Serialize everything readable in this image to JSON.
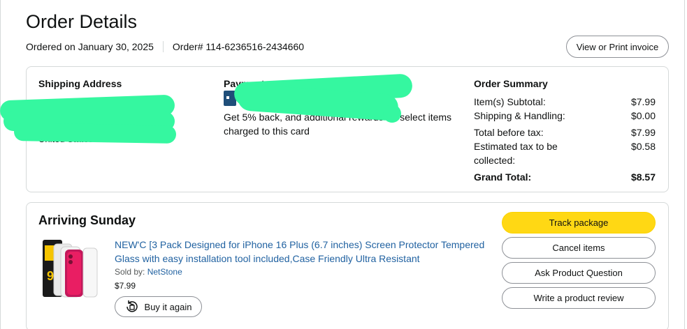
{
  "header": {
    "title": "Order Details",
    "ordered_on": "Ordered on January 30, 2025",
    "order_number": "Order# 114-6236516-2434660",
    "invoice_button": "View or Print invoice"
  },
  "shipping": {
    "label": "Shipping Address",
    "country": "United States"
  },
  "payment": {
    "label": "Payment method",
    "reward_text": "Get 5% back, and additional rewards on select items charged to this card"
  },
  "summary": {
    "label": "Order Summary",
    "rows": [
      {
        "label": "Item(s) Subtotal:",
        "value": "$7.99"
      },
      {
        "label": "Shipping & Handling:",
        "value": "$0.00"
      },
      {
        "label": "Total before tax:",
        "value": "$7.99"
      },
      {
        "label": "Estimated tax to be collected:",
        "value": "$0.58"
      }
    ],
    "grand_total_label": "Grand Total:",
    "grand_total_value": "$8.57"
  },
  "shipment": {
    "status": "Arriving Sunday",
    "product_title": "NEW'C [3 Pack Designed for iPhone 16 Plus (6.7 inches) Screen Protector Tempered Glass with easy installation tool included,Case Friendly Ultra Resistant",
    "sold_by_label": "Sold by: ",
    "seller": "NetStone",
    "price": "$7.99",
    "buy_again": "Buy it again",
    "actions": {
      "track": "Track package",
      "cancel": "Cancel items",
      "question": "Ask Product Question",
      "review": "Write a product review"
    }
  },
  "colors": {
    "primary_button": "#ffd814",
    "link": "#2162a1",
    "redaction": "#35f7a0"
  }
}
